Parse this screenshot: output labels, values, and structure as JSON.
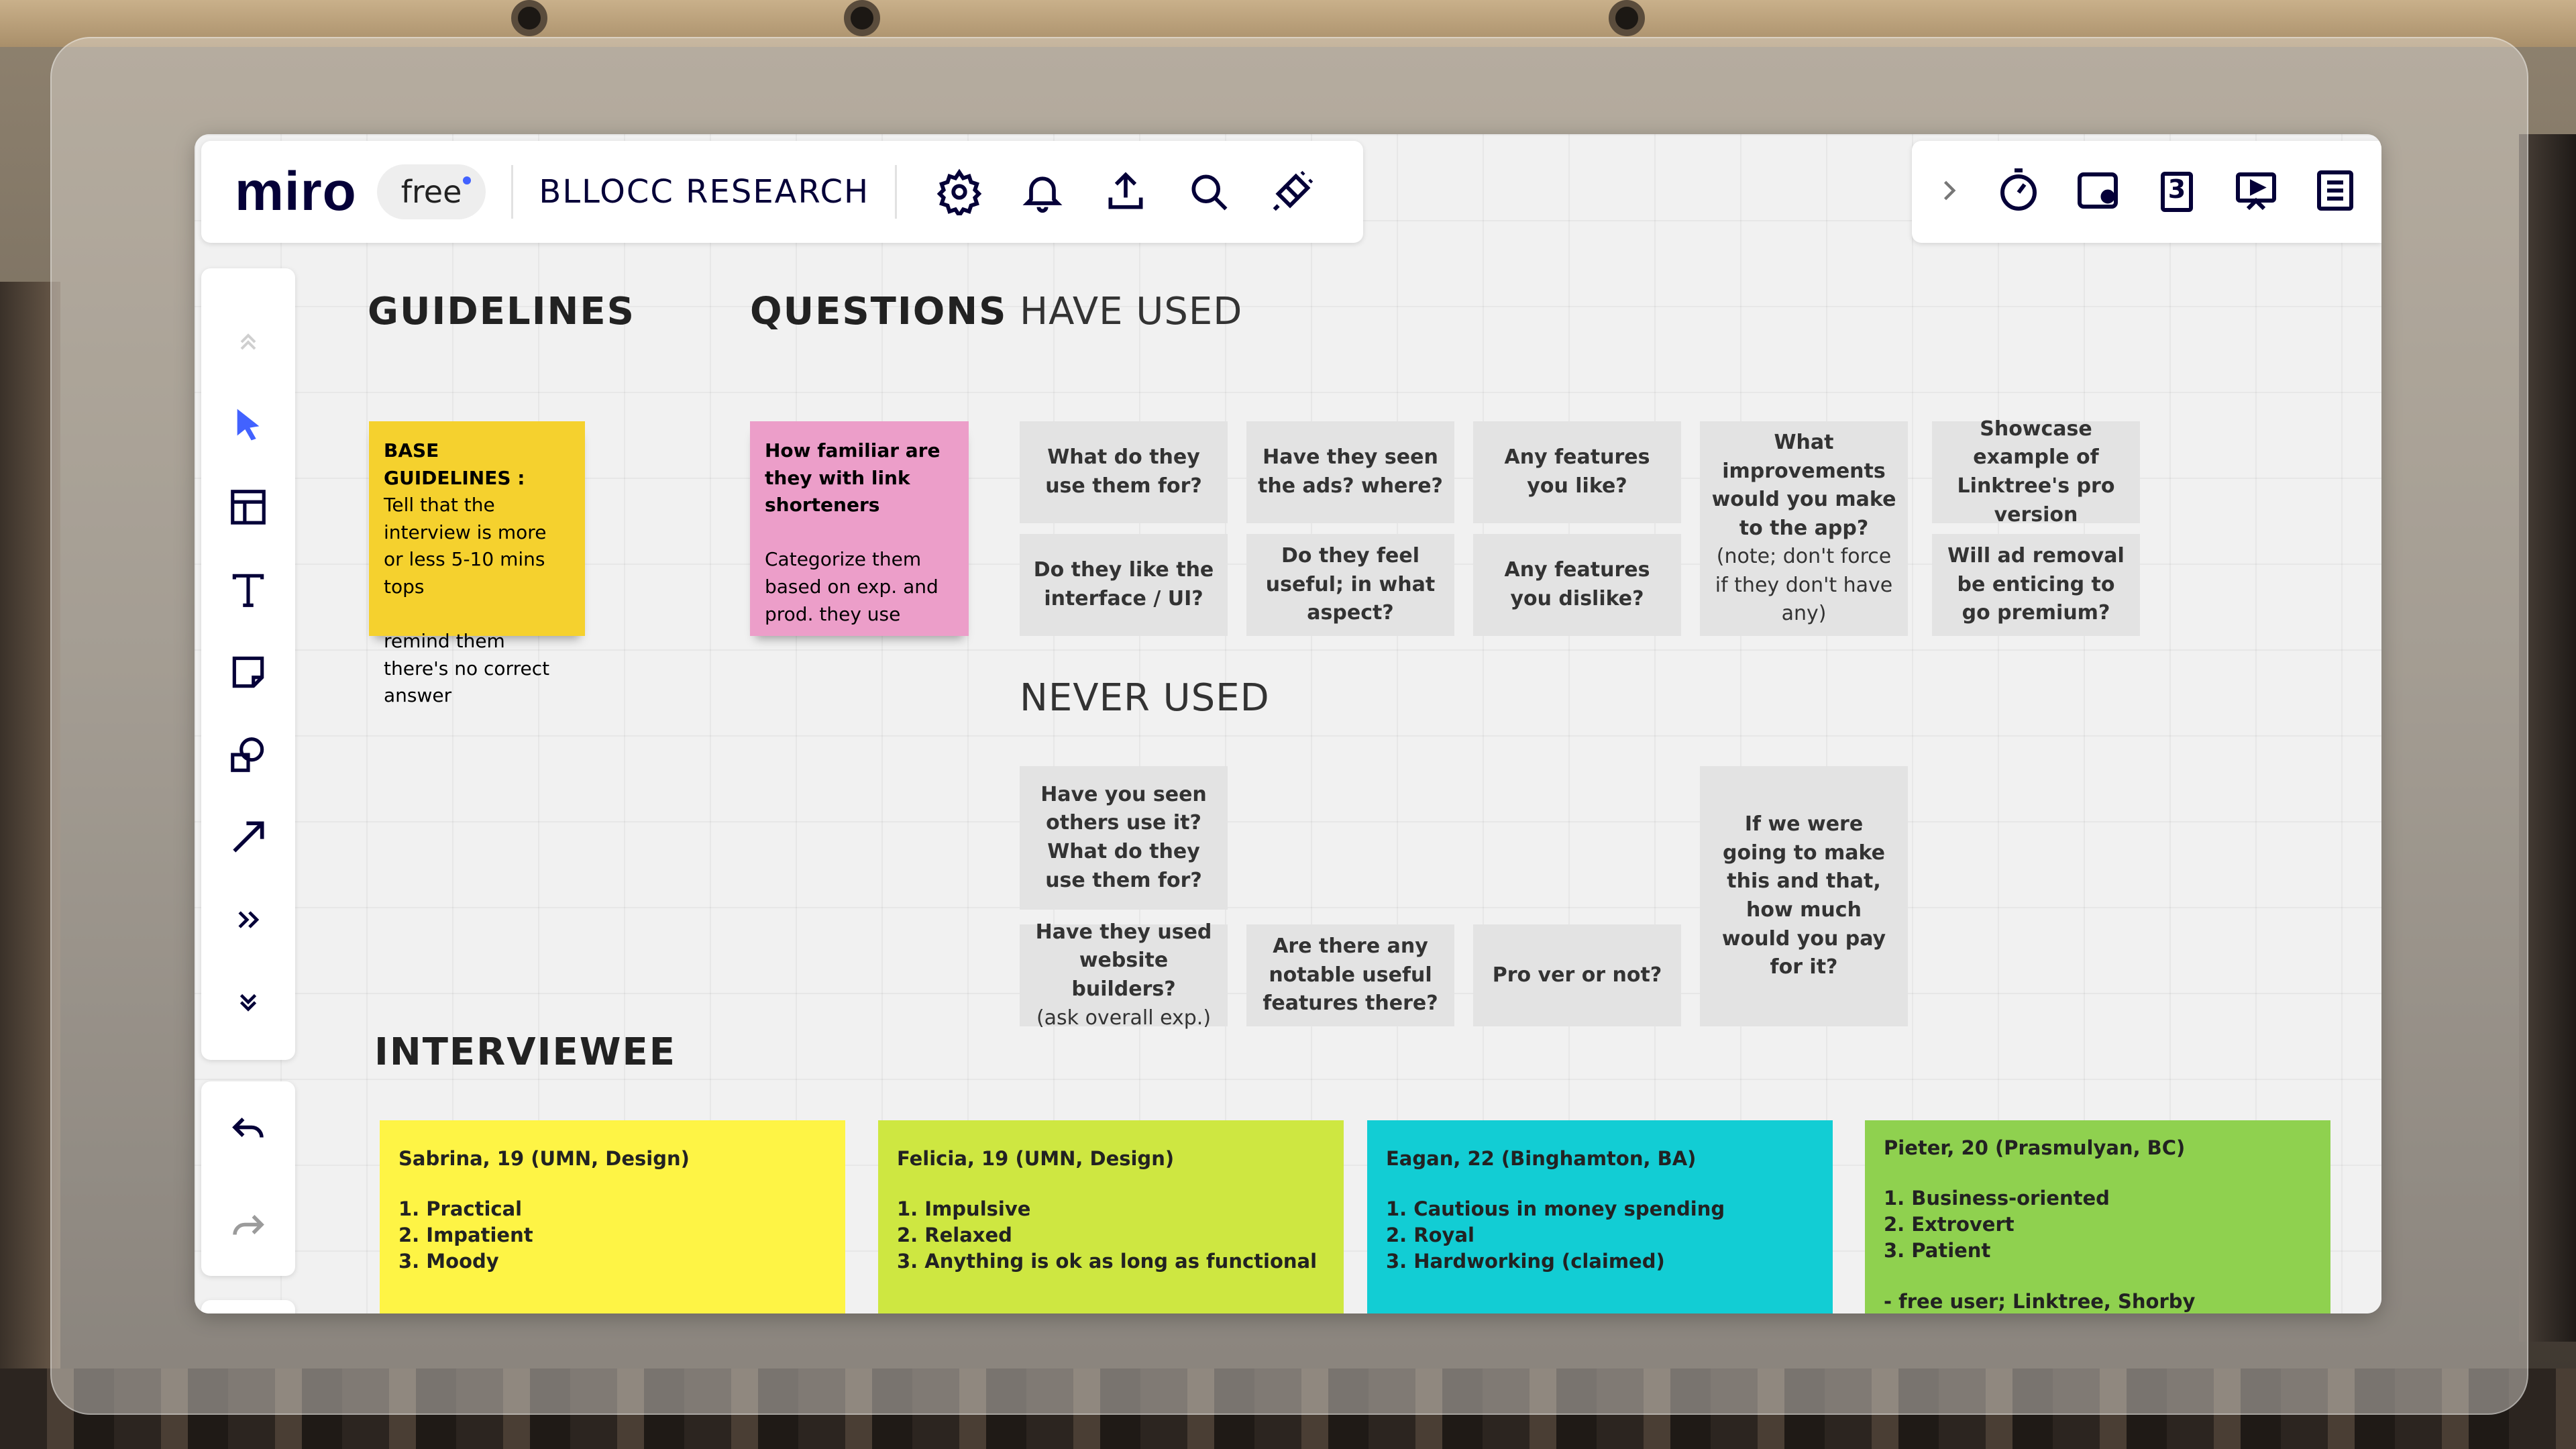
{
  "app": {
    "logo": "miro",
    "plan_badge": "free",
    "board_title": "BLLOCC RESEARCH"
  },
  "toolbar": {
    "icons": [
      "gear-icon",
      "bell-icon",
      "upload-icon",
      "search-icon",
      "plug-icon"
    ]
  },
  "rightbar": {
    "icons": [
      "chevron-right-icon",
      "timer-icon",
      "sticky-card-icon",
      "vote-count-icon",
      "presentation-icon",
      "notes-icon"
    ],
    "vote_number": "3"
  },
  "rail": {
    "tools": [
      "collapse-up-icon",
      "select-cursor-icon",
      "templates-icon",
      "text-tool-icon",
      "sticky-note-tool-icon",
      "shapes-tool-icon",
      "connector-arrow-icon",
      "more-tools-icon",
      "collapse-down-icon"
    ],
    "history": [
      "undo-icon",
      "redo-icon"
    ]
  },
  "headings": {
    "guidelines": "GUIDELINES",
    "questions": "QUESTIONS",
    "have_used": "HAVE USED",
    "never_used": "NEVER USED",
    "interviewee": "INTERVIEWEE"
  },
  "stickies": {
    "guidelines": {
      "title": "BASE GUIDELINES :",
      "body": "Tell that the interview is more or less 5-10 mins tops\n\nremind them there's no correct answer",
      "color": "#f5d12e"
    },
    "questions": {
      "title": "How familiar are they with link shorteners",
      "body": "\nCategorize them based on exp. and prod. they use",
      "color": "#ec9ec9"
    }
  },
  "have_used": [
    {
      "q": "What do they use them for?"
    },
    {
      "q": "Have they seen the ads? where?"
    },
    {
      "q": "Any features you like?"
    },
    {
      "q": "What improvements would you make to the app?",
      "note": "(note; don't force if they don't have any)"
    },
    {
      "q": "Showcase example of Linktree's pro version"
    },
    {
      "q": "Do they like the interface / UI?"
    },
    {
      "q": "Do they feel useful; in what aspect?"
    },
    {
      "q": "Any features you dislike?"
    },
    {
      "q": "Will ad removal be enticing to go premium?"
    }
  ],
  "never_used": [
    {
      "q": "Have you seen others use it? What do they use them for?"
    },
    {
      "q": "If we were going to make this and that, how much would you pay for it?"
    },
    {
      "q": "Have they used website builders?",
      "note": "(ask overall exp.)"
    },
    {
      "q": "Are there any notable useful features there?"
    },
    {
      "q": "Pro ver or not?"
    }
  ],
  "interviewees": [
    {
      "name": "Sabrina, 19 (UMN, Design)",
      "traits": [
        "1. Practical",
        "2. Impatient",
        "3. Moody"
      ],
      "color": "#fef445"
    },
    {
      "name": "Felicia, 19 (UMN, Design)",
      "traits": [
        "1. Impulsive",
        "2. Relaxed",
        "3. Anything is ok as long as functional"
      ],
      "color": "#cee741"
    },
    {
      "name": "Eagan, 22 (Binghamton, BA)",
      "traits": [
        "1. Cautious in money spending",
        "2. Royal",
        "3. Hardworking (claimed)"
      ],
      "color": "#12cdd4"
    },
    {
      "name": "Pieter, 20 (Prasmulyan, BC)",
      "traits": [
        "1. Business-oriented",
        "2. Extrovert",
        "3. Patient"
      ],
      "extra": "- free user; Linktree, Shorby",
      "color": "#8fd14f"
    }
  ]
}
